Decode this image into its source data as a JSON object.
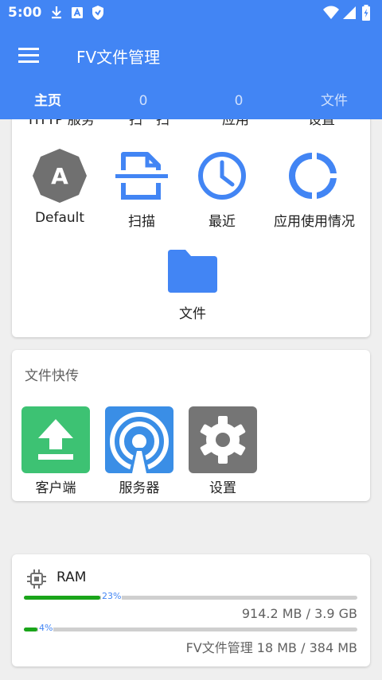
{
  "status_bar": {
    "time": "5:00"
  },
  "app": {
    "title": "FV文件管理"
  },
  "tabs": [
    {
      "label": "主页",
      "active": true
    },
    {
      "label": "0",
      "active": false
    },
    {
      "label": "0",
      "active": false
    },
    {
      "label": "文件",
      "active": false
    }
  ],
  "tools_card": {
    "cut_row": [
      "HTTP 服务",
      "扫一扫",
      "应用",
      "设置"
    ],
    "items": [
      {
        "label": "Default",
        "icon": "theme-a-icon"
      },
      {
        "label": "扫描",
        "icon": "scan-document-icon"
      },
      {
        "label": "最近",
        "icon": "clock-icon"
      },
      {
        "label": "应用使用情况",
        "icon": "usage-ring-icon"
      },
      {
        "label": "文件",
        "icon": "folder-icon"
      }
    ]
  },
  "transfer_card": {
    "title": "文件快传",
    "items": [
      {
        "label": "客户端",
        "icon": "upload-icon",
        "color": "#3dc273"
      },
      {
        "label": "服务器",
        "icon": "broadcast-icon",
        "color": "#3a8ee6"
      },
      {
        "label": "设置",
        "icon": "gear-icon",
        "color": "#757575"
      }
    ]
  },
  "ram_card": {
    "title": "RAM",
    "system": {
      "percent_label": "23%",
      "percent": 23,
      "usage": "914.2 MB / 3.9 GB"
    },
    "app": {
      "percent_label": "4%",
      "percent": 4,
      "usage": "FV文件管理  18 MB / 384 MB"
    }
  },
  "colors": {
    "primary": "#4285f4",
    "progress": "#1aa51a",
    "background": "#efefef"
  }
}
